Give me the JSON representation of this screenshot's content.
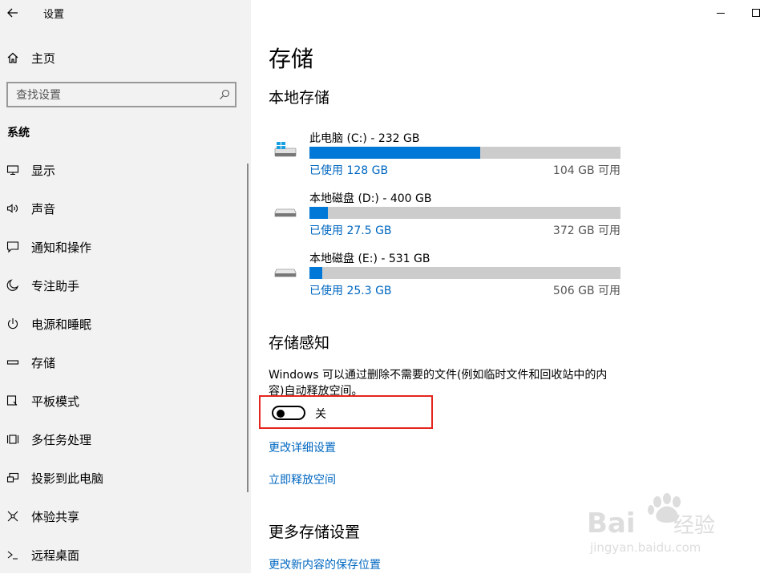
{
  "window": {
    "title": "设置",
    "maximize_icon": "maximize-icon",
    "minimize_icon": "minimize-icon"
  },
  "sidebar": {
    "home_label": "主页",
    "search_placeholder": "查找设置",
    "section_header": "系统",
    "items": [
      {
        "label": "显示",
        "icon": "display-icon"
      },
      {
        "label": "声音",
        "icon": "sound-icon"
      },
      {
        "label": "通知和操作",
        "icon": "notification-icon"
      },
      {
        "label": "专注助手",
        "icon": "moon-icon"
      },
      {
        "label": "电源和睡眠",
        "icon": "power-icon"
      },
      {
        "label": "存储",
        "icon": "storage-icon"
      },
      {
        "label": "平板模式",
        "icon": "tablet-icon"
      },
      {
        "label": "多任务处理",
        "icon": "multitask-icon"
      },
      {
        "label": "投影到此电脑",
        "icon": "project-icon"
      },
      {
        "label": "体验共享",
        "icon": "share-icon"
      },
      {
        "label": "远程桌面",
        "icon": "remote-icon"
      }
    ]
  },
  "main": {
    "title": "存储",
    "local_storage_title": "本地存储",
    "drives": [
      {
        "name": "此电脑 (C:) - 232 GB",
        "used": "已使用 128 GB",
        "free": "104 GB 可用",
        "used_fraction": 0.55,
        "icon": "windows-drive-icon"
      },
      {
        "name": "本地磁盘 (D:) - 400 GB",
        "used": "已使用 27.5 GB",
        "free": "372 GB 可用",
        "used_fraction": 0.06,
        "icon": "hard-drive-icon"
      },
      {
        "name": "本地磁盘 (E:) - 531 GB",
        "used": "已使用 25.3 GB",
        "free": "506 GB 可用",
        "used_fraction": 0.04,
        "icon": "hard-drive-icon"
      }
    ],
    "storage_sense_title": "存储感知",
    "storage_sense_desc": "Windows 可以通过删除不需要的文件(例如临时文件和回收站中的内容)自动释放空间。",
    "toggle_state": "关",
    "toggle_on": false,
    "link_change_settings": "更改详细设置",
    "link_free_space": "立即释放空间",
    "more_storage_title": "更多存储设置",
    "link_change_save_location": "更改新内容的保存位置"
  },
  "colors": {
    "accent": "#0078d7",
    "link": "#0067c0",
    "highlight_box": "#e5251e",
    "sidebar_bg": "#f2f2f2"
  }
}
